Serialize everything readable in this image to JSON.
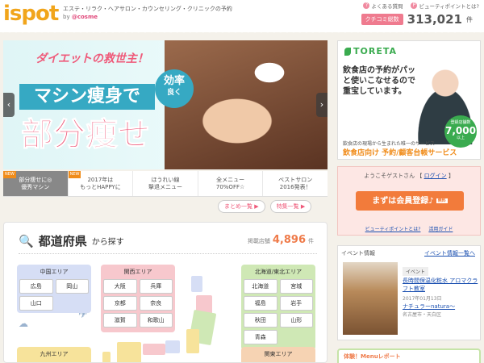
{
  "header": {
    "logo": "ispot",
    "tagline": "エステ・リラク・ヘアサロン・カウンセリング・クリニックの予約",
    "by": "by ",
    "by_brand": "@cosme",
    "links": [
      "よくある質問",
      "ビューティポイントとは?"
    ],
    "kuchikomi_label": "クチコミ総数",
    "kuchikomi_count": "313,021",
    "kuchikomi_unit": "件"
  },
  "hero": {
    "catch": "ダイエットの救世主！",
    "title1": "マシン痩身で",
    "title2": "部分痩せ",
    "circle_top": "効率",
    "circle_bottom": "良く",
    "tabs": [
      {
        "label": "部分痩せに◎\n優秀マシン",
        "new": "NEW",
        "active": true
      },
      {
        "label": "2017年は\nもっとHAPPYに",
        "new": "NEW",
        "active": false
      },
      {
        "label": "ほうれい線\n撃退メニュー",
        "new": "",
        "active": false
      },
      {
        "label": "全メニュー\n70%OFF☆",
        "new": "",
        "active": false
      },
      {
        "label": "ベストサロン\n2016発表！",
        "new": "",
        "active": false
      }
    ],
    "subtabs": [
      "まとめ一覧",
      "特集一覧"
    ]
  },
  "region": {
    "title": "都道府県",
    "title_suffix": "から探す",
    "count_label": "掲載店舗",
    "count": "4,896",
    "count_unit": "件",
    "areas": {
      "chugoku": {
        "name": "中国エリア",
        "prefs": [
          "広島",
          "岡山",
          "山口"
        ]
      },
      "kansai": {
        "name": "関西エリア",
        "prefs": [
          "大阪",
          "兵庫",
          "京都",
          "奈良",
          "滋賀",
          "和歌山"
        ]
      },
      "hokkaido": {
        "name": "北海道/東北エリア",
        "prefs": [
          "北海道",
          "宮城",
          "福島",
          "岩手",
          "秋田",
          "山形",
          "青森"
        ]
      },
      "kyushu": {
        "name": "九州エリア"
      },
      "kanto": {
        "name": "関東エリア"
      }
    }
  },
  "ad": {
    "brand": "TORETA",
    "copy": "飲食店の予約がパッと使いこなせるので重宝しています。",
    "badge_top": "登録店舗数",
    "badge_num": "7,000",
    "badge_unit": "以上",
    "foot1": "飲食店の現場から生まれた唯一のサービス",
    "foot2": "飲食店向け 予約/顧客台帳サービス"
  },
  "guest": {
    "greeting": "ようこそゲストさん",
    "login": "ログイン",
    "register": "まずは会員登録♪",
    "free": "無料",
    "links": [
      "ビューティポイントとは?",
      "活用ガイド"
    ]
  },
  "event": {
    "head": "イベント情報",
    "more": "イベント情報一覧へ",
    "tag": "イベント",
    "title": "長時間保温化粧水 アロマクラフト教室",
    "date": "2017年01月13日",
    "salon": "ナチュラーnatura〜",
    "place": "名古屋市・天白区"
  },
  "report": "体験！Menuレポート"
}
